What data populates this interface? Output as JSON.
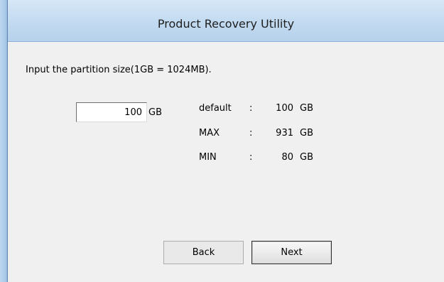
{
  "window": {
    "title": "Product Recovery Utility"
  },
  "form": {
    "instruction": "Input the partition size(1GB = 1024MB).",
    "size_value": "100",
    "size_unit": "GB"
  },
  "info": [
    {
      "label": "default",
      "colon": ":",
      "value": "100",
      "unit": "GB"
    },
    {
      "label": "MAX",
      "colon": ":",
      "value": "931",
      "unit": "GB"
    },
    {
      "label": "MIN",
      "colon": ":",
      "value": "80",
      "unit": "GB"
    }
  ],
  "buttons": {
    "back_label": "Back",
    "next_label": "Next"
  },
  "colors": {
    "titlebar": "#c5dcf1",
    "content_bg": "#f0f0f0",
    "frame": "#a9c9e7"
  }
}
